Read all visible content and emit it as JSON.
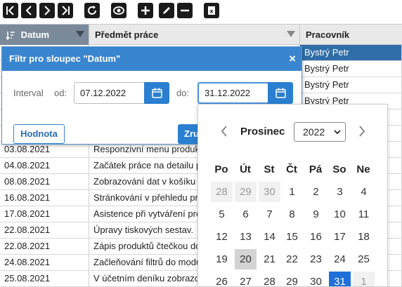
{
  "toolbar": {
    "buttons": [
      {
        "icon": "first-page-icon"
      },
      {
        "icon": "previous-page-icon"
      },
      {
        "icon": "next-page-icon"
      },
      {
        "icon": "last-page-icon"
      },
      {
        "icon": "refresh-icon"
      },
      {
        "icon": "eye-icon"
      },
      {
        "icon": "plus-icon"
      },
      {
        "icon": "pencil-icon"
      },
      {
        "icon": "minus-icon"
      },
      {
        "icon": "excel-export-icon"
      }
    ]
  },
  "grid": {
    "columns": [
      {
        "label": "Datum",
        "sorted": true
      },
      {
        "label": "Předmět práce",
        "sorted": false
      },
      {
        "label": "Pracovník",
        "sorted": false
      }
    ],
    "rows": [
      {
        "date": "",
        "subject": "",
        "worker": "Bystrý Petr",
        "selected": true
      },
      {
        "date": "",
        "subject": "",
        "worker": "Bystrý Petr",
        "selected": false
      },
      {
        "date": "",
        "subject": "",
        "worker": "Bystrý Petr",
        "selected": false
      },
      {
        "date": "",
        "subject": "",
        "worker": "Bystrý Petr",
        "selected": false
      },
      {
        "date": "",
        "subject": "",
        "worker": "",
        "selected": false
      },
      {
        "date": "",
        "subject": "",
        "worker": "",
        "selected": false
      },
      {
        "date": "03.08.2021",
        "subject": "Responzivní menu produkt",
        "worker": "",
        "selected": false
      },
      {
        "date": "04.08.2021",
        "subject": "Začátek práce na detailu p",
        "worker": "",
        "selected": false
      },
      {
        "date": "08.08.2021",
        "subject": "Zobrazování dat v košíku",
        "worker": "",
        "selected": false
      },
      {
        "date": "16.08.2021",
        "subject": "Stránkování v přehledu pro",
        "worker": "",
        "selected": false
      },
      {
        "date": "17.08.2021",
        "subject": "Asistence při vytváření pro",
        "worker": "",
        "selected": false
      },
      {
        "date": "22.08.2021",
        "subject": "Úpravy tiskových sestav.",
        "worker": "",
        "selected": false
      },
      {
        "date": "22.08.2021",
        "subject": "Zápis produktů čtečkou do",
        "worker": "",
        "selected": false
      },
      {
        "date": "24.08.2021",
        "subject": "Začleňování filtrů do modu",
        "worker": "",
        "selected": false
      },
      {
        "date": "25.08.2021",
        "subject": "V účetním deníku zobrazo",
        "worker": "",
        "selected": false
      }
    ]
  },
  "filter_dialog": {
    "title": "Filtr pro sloupec \"Datum\"",
    "close_label": "×",
    "interval_label": "Interval",
    "from_label": "od:",
    "from_value": "07.12.2022",
    "to_label": "do:",
    "to_value": "31.12.2022",
    "value_button_label": "Hodnota",
    "cancel_button_label": "Zru"
  },
  "calendar": {
    "month": "Prosinec",
    "year": "2022",
    "weekdays": [
      "Po",
      "Út",
      "St",
      "Čt",
      "Pá",
      "So",
      "Ne"
    ],
    "weeks": [
      [
        {
          "d": "28",
          "t": "other"
        },
        {
          "d": "29",
          "t": "other"
        },
        {
          "d": "30",
          "t": "other"
        },
        {
          "d": "1",
          "t": ""
        },
        {
          "d": "2",
          "t": ""
        },
        {
          "d": "3",
          "t": ""
        },
        {
          "d": "4",
          "t": ""
        }
      ],
      [
        {
          "d": "5",
          "t": ""
        },
        {
          "d": "6",
          "t": ""
        },
        {
          "d": "7",
          "t": ""
        },
        {
          "d": "8",
          "t": ""
        },
        {
          "d": "9",
          "t": ""
        },
        {
          "d": "10",
          "t": ""
        },
        {
          "d": "11",
          "t": ""
        }
      ],
      [
        {
          "d": "12",
          "t": ""
        },
        {
          "d": "13",
          "t": ""
        },
        {
          "d": "14",
          "t": ""
        },
        {
          "d": "15",
          "t": ""
        },
        {
          "d": "16",
          "t": ""
        },
        {
          "d": "17",
          "t": ""
        },
        {
          "d": "18",
          "t": ""
        }
      ],
      [
        {
          "d": "19",
          "t": ""
        },
        {
          "d": "20",
          "t": "today"
        },
        {
          "d": "21",
          "t": ""
        },
        {
          "d": "22",
          "t": ""
        },
        {
          "d": "23",
          "t": ""
        },
        {
          "d": "24",
          "t": ""
        },
        {
          "d": "25",
          "t": ""
        }
      ],
      [
        {
          "d": "26",
          "t": ""
        },
        {
          "d": "27",
          "t": ""
        },
        {
          "d": "28",
          "t": ""
        },
        {
          "d": "29",
          "t": ""
        },
        {
          "d": "30",
          "t": ""
        },
        {
          "d": "31",
          "t": "selected"
        },
        {
          "d": "1",
          "t": "other"
        }
      ]
    ]
  },
  "colors": {
    "accent": "#2a7fd0",
    "dialog_title_bg": "#3a85cf",
    "selected_row": "#2f6ea8",
    "sorted_header": "#7a8a9a"
  }
}
